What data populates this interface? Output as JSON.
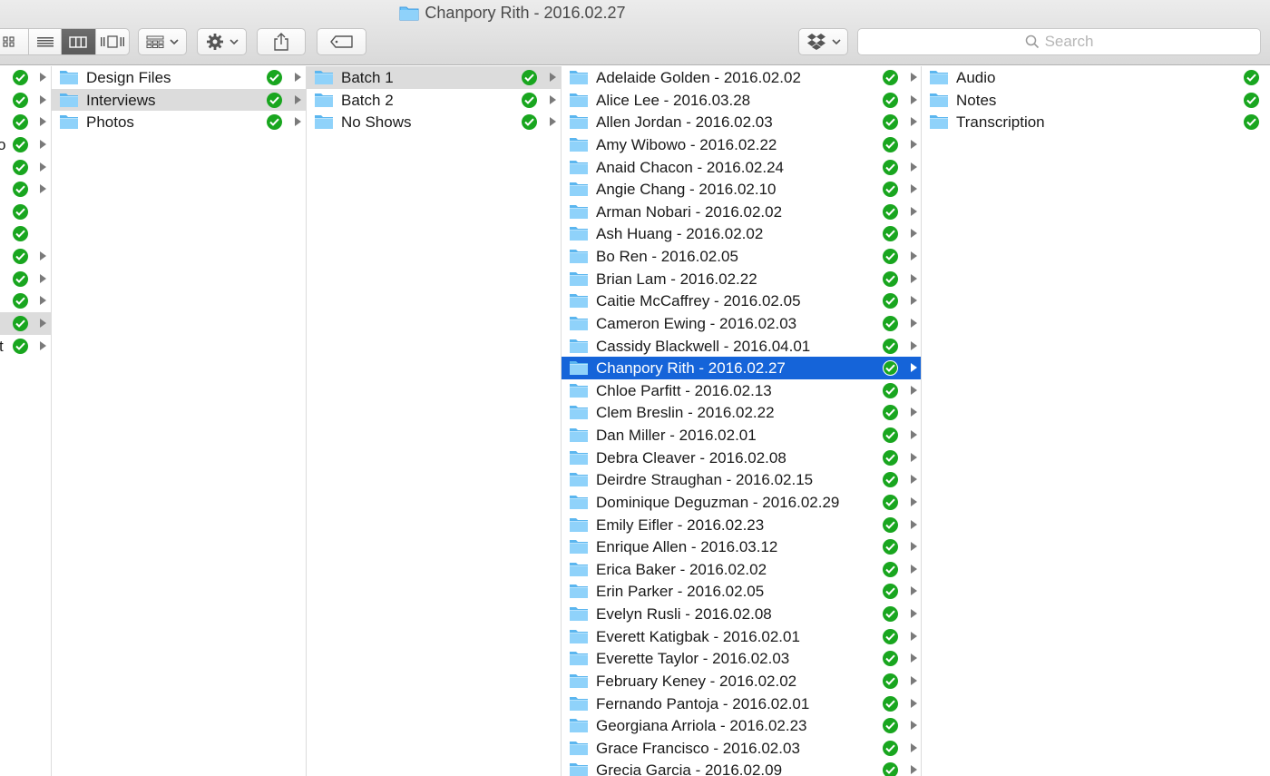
{
  "window": {
    "title": "Chanpory Rith - 2016.02.27"
  },
  "toolbar": {
    "view_buttons": [
      "icon-view",
      "list-view",
      "column-view",
      "cover-flow-view"
    ],
    "active_view": "column-view",
    "arrange_icon": "arrange-grid-icon",
    "action_icon": "gear-icon",
    "share_icon": "share-icon",
    "tags_icon": "tag-icon",
    "dropbox_icon": "dropbox-icon",
    "search": {
      "placeholder": "Search"
    }
  },
  "colors": {
    "accent_selection": "#1564d9",
    "inactive_selection": "#dcdcdc",
    "synced_badge": "#19a61f",
    "folder": "#6ec3f7"
  },
  "column0": {
    "partial_texts": {
      "row4": "o",
      "row13": "t"
    }
  },
  "column1": {
    "items": [
      {
        "name": "Design Files"
      },
      {
        "name": "Interviews"
      },
      {
        "name": "Photos"
      }
    ],
    "selected": "Interviews"
  },
  "column2": {
    "items": [
      {
        "name": "Batch 1"
      },
      {
        "name": "Batch 2"
      },
      {
        "name": "No Shows"
      }
    ],
    "selected": "Batch 1"
  },
  "column3": {
    "items": [
      {
        "name": "Adelaide Golden - 2016.02.02"
      },
      {
        "name": "Alice Lee - 2016.03.28"
      },
      {
        "name": "Allen Jordan - 2016.02.03"
      },
      {
        "name": "Amy Wibowo - 2016.02.22"
      },
      {
        "name": "Anaid Chacon - 2016.02.24"
      },
      {
        "name": "Angie Chang - 2016.02.10"
      },
      {
        "name": "Arman Nobari - 2016.02.02"
      },
      {
        "name": "Ash Huang - 2016.02.02"
      },
      {
        "name": "Bo Ren - 2016.02.05"
      },
      {
        "name": "Brian Lam - 2016.02.22"
      },
      {
        "name": "Caitie McCaffrey - 2016.02.05"
      },
      {
        "name": "Cameron Ewing - 2016.02.03"
      },
      {
        "name": "Cassidy Blackwell - 2016.04.01"
      },
      {
        "name": "Chanpory Rith - 2016.02.27"
      },
      {
        "name": "Chloe Parfitt - 2016.02.13"
      },
      {
        "name": "Clem Breslin - 2016.02.22"
      },
      {
        "name": "Dan Miller - 2016.02.01"
      },
      {
        "name": "Debra Cleaver - 2016.02.08"
      },
      {
        "name": "Deirdre Straughan - 2016.02.15"
      },
      {
        "name": "Dominique Deguzman - 2016.02.29"
      },
      {
        "name": "Emily Eifler - 2016.02.23"
      },
      {
        "name": "Enrique Allen - 2016.03.12"
      },
      {
        "name": "Erica Baker - 2016.02.02"
      },
      {
        "name": "Erin Parker - 2016.02.05"
      },
      {
        "name": "Evelyn Rusli - 2016.02.08"
      },
      {
        "name": "Everett Katigbak - 2016.02.01"
      },
      {
        "name": "Everette Taylor - 2016.02.03"
      },
      {
        "name": "February Keney - 2016.02.02"
      },
      {
        "name": "Fernando Pantoja - 2016.02.01"
      },
      {
        "name": "Georgiana Arriola - 2016.02.23"
      },
      {
        "name": "Grace Francisco - 2016.02.03"
      },
      {
        "name": "Grecia Garcia - 2016.02.09"
      }
    ],
    "selected": "Chanpory Rith - 2016.02.27"
  },
  "column4": {
    "items": [
      {
        "name": "Audio"
      },
      {
        "name": "Notes"
      },
      {
        "name": "Transcription"
      }
    ]
  }
}
